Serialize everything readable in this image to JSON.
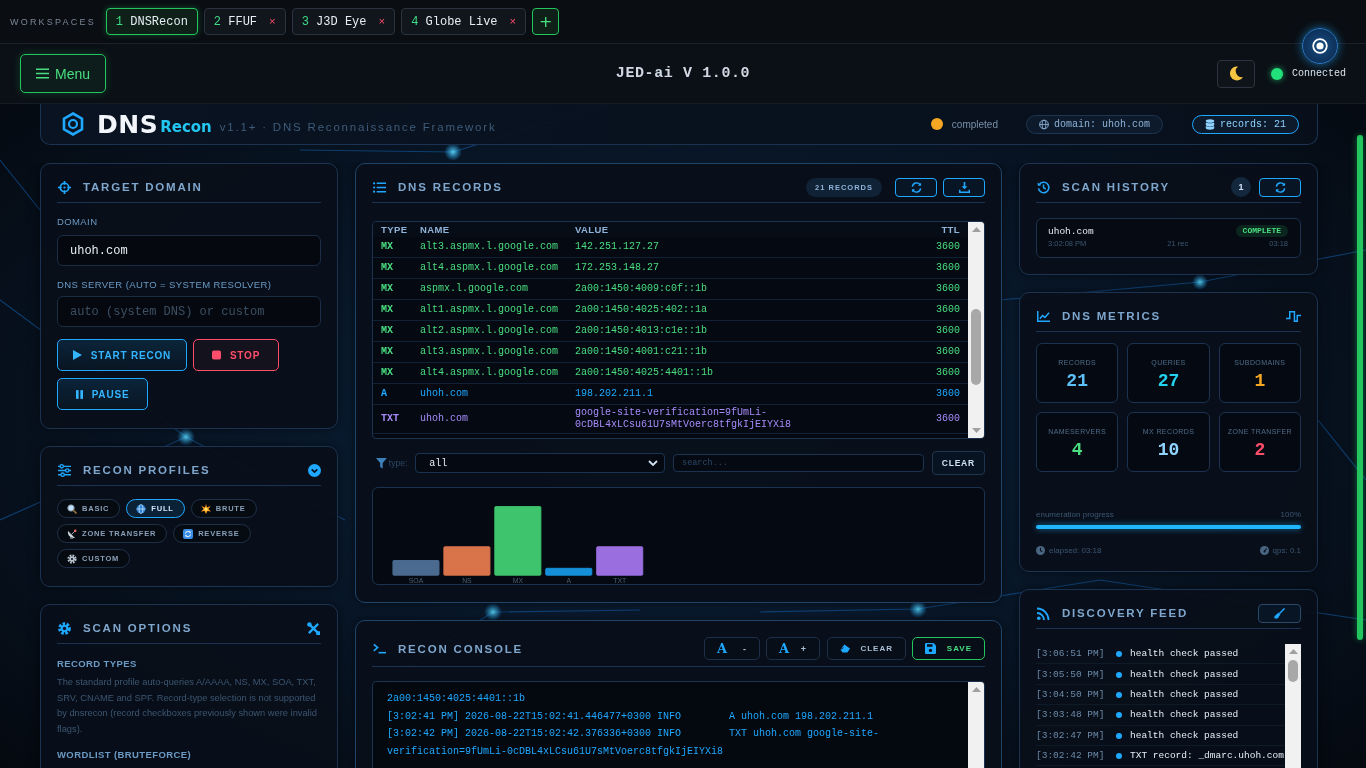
{
  "workspace_bar": {
    "label": "WORKSPACES",
    "tabs": [
      {
        "number": "1",
        "label": "DNSRecon",
        "selected": true
      },
      {
        "number": "2",
        "label": "FFUF",
        "selected": false,
        "close": "×"
      },
      {
        "number": "3",
        "label": "J3D Eye",
        "selected": false,
        "close": "×"
      },
      {
        "number": "4",
        "label": "Globe Live",
        "selected": false,
        "close": "×"
      }
    ],
    "add_button": "+"
  },
  "header": {
    "menu_button": "Menu",
    "title": "JED-ai V 1.0.0",
    "connection": {
      "label": "Connected",
      "online": true
    }
  },
  "hero": {
    "logo_main": "DNS",
    "logo_sub": "Recon",
    "tagline": "v1.1+ · DNS Reconnaissance Framework",
    "status": "completed",
    "domain_pill": "domain: uhoh.com",
    "records_pill": "records: 21"
  },
  "target_domain": {
    "title": "TARGET DOMAIN",
    "domain_label": "DOMAIN",
    "domain_value": "uhoh.com",
    "server_label": "DNS SERVER (AUTO = SYSTEM RESOLVER)",
    "server_placeholder": "auto (system DNS) or custom",
    "buttons": [
      {
        "kind": "start",
        "label": "START RECON"
      },
      {
        "kind": "stop",
        "label": "STOP"
      },
      {
        "kind": "pause",
        "label": "PAUSE"
      }
    ]
  },
  "recon_profiles": {
    "title": "RECON PROFILES",
    "profiles": [
      {
        "label": "BASIC",
        "selected": false
      },
      {
        "label": "FULL",
        "selected": true
      },
      {
        "label": "BRUTE",
        "selected": false
      },
      {
        "label": "ZONE TRANSFER",
        "selected": false
      },
      {
        "label": "REVERSE",
        "selected": false
      },
      {
        "label": "CUSTOM",
        "selected": false
      }
    ]
  },
  "scan_options": {
    "title": "SCAN OPTIONS",
    "record_types_label": "RECORD TYPES",
    "note": "The standard profile auto-queries A/AAAA, NS, MX, SOA, TXT, SRV, CNAME and SPF. Record-type selection is not supported by dnsrecon (record checkboxes previously shown were invalid flags).",
    "wordlist_label": "WORDLIST (BRUTEFORCE)"
  },
  "dns_records": {
    "title": "DNS RECORDS",
    "count_badge": "21 RECORDS",
    "table": {
      "columns": [
        "TYPE",
        "NAME",
        "VALUE",
        "TTL"
      ],
      "rows": [
        {
          "type": "MX",
          "name": "alt3.aspmx.l.google.com",
          "value": "142.251.127.27",
          "ttl": "3600",
          "color": "#4ade80"
        },
        {
          "type": "MX",
          "name": "alt4.aspmx.l.google.com",
          "value": "172.253.148.27",
          "ttl": "3600",
          "color": "#4ade80"
        },
        {
          "type": "MX",
          "name": "aspmx.l.google.com",
          "value": "2a00:1450:4009:c0f::1b",
          "ttl": "3600",
          "color": "#4ade80"
        },
        {
          "type": "MX",
          "name": "alt1.aspmx.l.google.com",
          "value": "2a00:1450:4025:402::1a",
          "ttl": "3600",
          "color": "#4ade80"
        },
        {
          "type": "MX",
          "name": "alt2.aspmx.l.google.com",
          "value": "2a00:1450:4013:c1e::1b",
          "ttl": "3600",
          "color": "#4ade80"
        },
        {
          "type": "MX",
          "name": "alt3.aspmx.l.google.com",
          "value": "2a00:1450:4001:c21::1b",
          "ttl": "3600",
          "color": "#4ade80"
        },
        {
          "type": "MX",
          "name": "alt4.aspmx.l.google.com",
          "value": "2a00:1450:4025:4401::1b",
          "ttl": "3600",
          "color": "#4ade80"
        },
        {
          "type": "A",
          "name": "uhoh.com",
          "value": "198.202.211.1",
          "ttl": "3600",
          "color": "#1fa8ff"
        },
        {
          "type": "TXT",
          "name": "uhoh.com",
          "value": "google-site-verification=9fUmLi-0cDBL4xLCsu61U7sMtVoerc8tfgkIjEIYXi8",
          "ttl": "3600",
          "color": "#a78bfa"
        }
      ]
    },
    "filter": {
      "label": "type:",
      "select_value": "all",
      "search_placeholder": "search...",
      "clear_button": "CLEAR"
    },
    "chart": {
      "bars": [
        {
          "label": "SOA",
          "color": "#4a6a8f"
        },
        {
          "label": "NS",
          "color": "#d9734a"
        },
        {
          "label": "MX",
          "color": "#3ec46d"
        },
        {
          "label": "A",
          "color": "#1590d8"
        },
        {
          "label": "TXT",
          "color": "#9b6ee0"
        }
      ]
    }
  },
  "console": {
    "title": "RECON CONSOLE",
    "buttons": [
      {
        "kind": "font_down",
        "glyph": "A",
        "label": "-"
      },
      {
        "kind": "font_up",
        "glyph": "A",
        "label": "+"
      },
      {
        "kind": "clear",
        "label": "CLEAR"
      },
      {
        "kind": "save",
        "label": "SAVE"
      }
    ],
    "lines": [
      "2a00:1450:4025:4401::1b",
      "[3:02:41 PM] 2026-08-22T15:02:41.446477+0300 INFO        A uhoh.com 198.202.211.1",
      "[3:02:42 PM] 2026-08-22T15:02:42.376336+0300 INFO        TXT uhoh.com google-site-verification=9fUmLi-0cDBL4xLCsu61U7sMtVoerc8tfgkIjEIYXi8"
    ]
  },
  "scan_history": {
    "title": "SCAN HISTORY",
    "count": "1",
    "items": [
      {
        "domain": "uhoh.com",
        "status": "COMPLETE",
        "time": "3:02:08 PM",
        "records": "21 rec",
        "duration": "03:18"
      }
    ]
  },
  "dns_metrics": {
    "title": "DNS METRICS",
    "tiles": [
      {
        "label": "RECORDS",
        "value": "21",
        "color": "#5bc0f8"
      },
      {
        "label": "QUERIES",
        "value": "27",
        "color": "#22d3ee"
      },
      {
        "label": "SUBDOMAINS",
        "value": "1",
        "color": "#f5a623"
      },
      {
        "label": "NAMESERVERS",
        "value": "4",
        "color": "#4ade80"
      },
      {
        "label": "MX RECORDS",
        "value": "10",
        "color": "#8fd3ff"
      },
      {
        "label": "ZONE TRANSFER",
        "value": "2",
        "color": "#ff4d6a"
      }
    ],
    "progress": {
      "label": "enumeration progress",
      "reading": "100%",
      "level": 1
    },
    "elapsed": "elapsed: 03:18",
    "qps": "qps: 0.1"
  },
  "discovery_feed": {
    "title": "DISCOVERY FEED",
    "items": [
      {
        "time": "[3:06:51 PM]",
        "message": "health check passed"
      },
      {
        "time": "[3:05:50 PM]",
        "message": "health check passed"
      },
      {
        "time": "[3:04:50 PM]",
        "message": "health check passed"
      },
      {
        "time": "[3:03:48 PM]",
        "message": "health check passed"
      },
      {
        "time": "[3:02:47 PM]",
        "message": "health check passed"
      },
      {
        "time": "[3:02:42 PM]",
        "message": "TXT record: _dmarc.uhoh.com"
      }
    ]
  }
}
